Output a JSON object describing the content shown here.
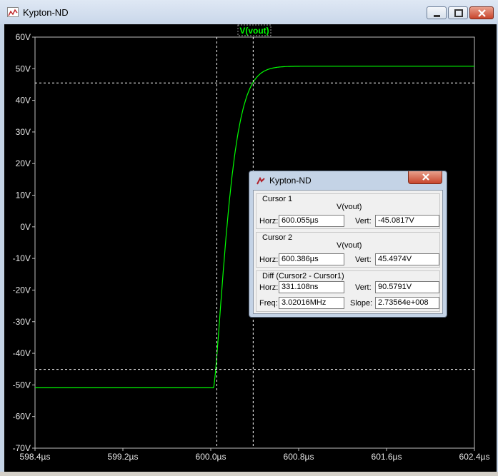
{
  "window": {
    "title": "Kypton-ND"
  },
  "plot": {
    "trace_label": "V(vout)",
    "y_ticks": [
      "60V",
      "50V",
      "40V",
      "30V",
      "20V",
      "10V",
      "0V",
      "-10V",
      "-20V",
      "-30V",
      "-40V",
      "-50V",
      "-60V",
      "-70V"
    ],
    "x_ticks": [
      "598.4µs",
      "599.2µs",
      "600.0µs",
      "600.8µs",
      "601.6µs",
      "602.4µs"
    ],
    "y_range_V": [
      -70,
      60
    ],
    "x_range_us": [
      598.4,
      602.4
    ],
    "cursor1": {
      "x_us": 600.055,
      "y_V": -45.0817
    },
    "cursor2": {
      "x_us": 600.386,
      "y_V": 45.4974
    },
    "trace_color": "#00ff00",
    "background": "#000000"
  },
  "dialog": {
    "title": "Kypton-ND",
    "cursor1": {
      "label": "Cursor 1",
      "trace": "V(vout)",
      "horz_label": "Horz:",
      "horz": "600.055µs",
      "vert_label": "Vert:",
      "vert": "-45.0817V"
    },
    "cursor2": {
      "label": "Cursor 2",
      "trace": "V(vout)",
      "horz_label": "Horz:",
      "horz": "600.386µs",
      "vert_label": "Vert:",
      "vert": "45.4974V"
    },
    "diff": {
      "label": "Diff (Cursor2 - Cursor1)",
      "horz_label": "Horz:",
      "horz": "331.108ns",
      "vert_label": "Vert:",
      "vert": "90.5791V",
      "freq_label": "Freq:",
      "freq": "3.02016MHz",
      "slope_label": "Slope:",
      "slope": "2.73564e+008"
    }
  }
}
